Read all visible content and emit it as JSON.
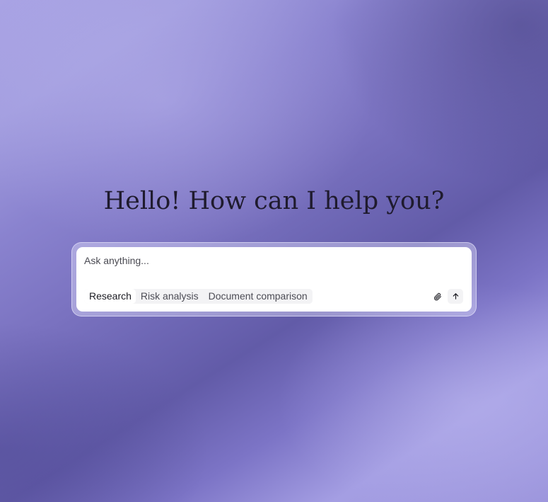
{
  "heading": "Hello! How can I help you?",
  "composer": {
    "placeholder": "Ask anything...",
    "value": "",
    "chips": [
      {
        "label": "Research",
        "active": true
      },
      {
        "label": "Risk analysis",
        "active": false
      },
      {
        "label": "Document comparison",
        "active": false
      }
    ],
    "icons": {
      "attach": "paperclip-icon",
      "send": "arrow-up-icon"
    }
  },
  "colors": {
    "heading_text": "#1f1b2e",
    "background_light": "#a9a3e4",
    "background_dark": "#625ba8",
    "panel": "#ffffff",
    "chip_bg": "#f3f3f5"
  }
}
